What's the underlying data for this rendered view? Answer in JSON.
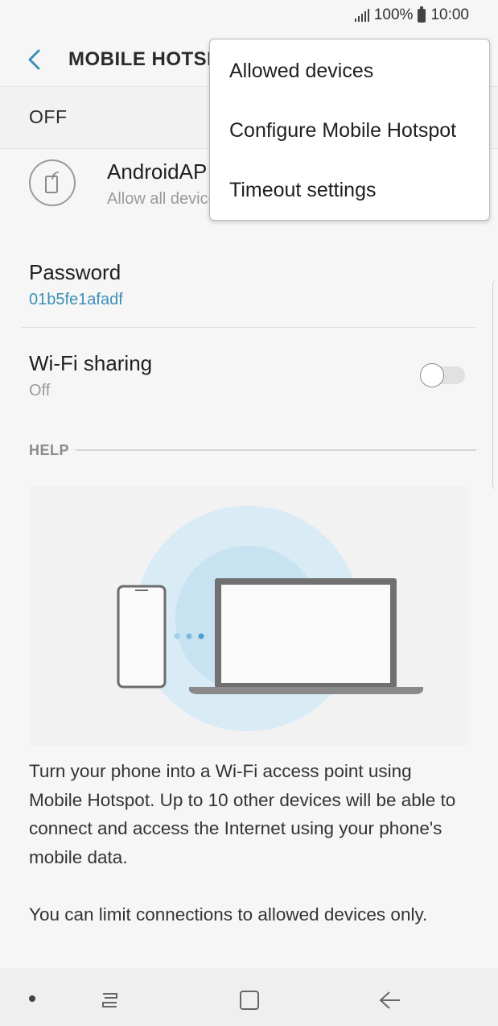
{
  "status_bar": {
    "battery_percent": "100%",
    "time": "10:00"
  },
  "header": {
    "title": "MOBILE HOTSPOT",
    "back_icon": "chevron-left-icon"
  },
  "master_switch": {
    "label": "OFF"
  },
  "network": {
    "name": "AndroidAP",
    "subtitle": "Allow all devices",
    "icon": "hotspot-phone-icon"
  },
  "password": {
    "label": "Password",
    "value": "01b5fe1afadf"
  },
  "wifi_sharing": {
    "label": "Wi-Fi sharing",
    "status": "Off",
    "enabled": false
  },
  "help": {
    "section_label": "HELP",
    "paragraph1": "Turn your phone into a Wi-Fi access point using Mobile Hotspot. Up to 10 other devices will be able to connect and access the Internet using your phone's mobile data.",
    "paragraph2": "You can limit connections to allowed devices only."
  },
  "menu": {
    "items": [
      {
        "label": "Allowed devices"
      },
      {
        "label": "Configure Mobile Hotspot"
      },
      {
        "label": "Timeout settings"
      }
    ]
  },
  "colors": {
    "accent": "#3d8fb8",
    "illustration_light": "#d9ebf5",
    "illustration_mid": "#c7e2f1"
  }
}
